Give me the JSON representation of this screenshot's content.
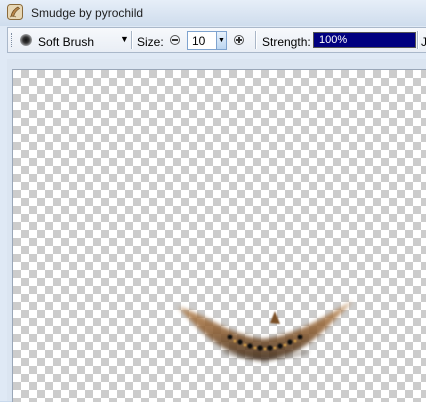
{
  "window": {
    "title": "Smudge by pyrochild"
  },
  "toolbar": {
    "brush_label": "Soft Brush",
    "size_label": "Size:",
    "size_value": "10",
    "strength_label": "Strength:",
    "strength_value": "100%",
    "strength_fraction": 1.0,
    "overflow_text": "J"
  },
  "icons": {
    "app": "smudge-finger-icon",
    "brush": "soft-brush-icon",
    "dropdown": "chevron-down-icon",
    "decrease": "minus-circle-icon",
    "increase": "plus-circle-icon",
    "spin": "spin-down-icon"
  },
  "colors": {
    "strength_fill": "#000080",
    "checker_light": "#ffffff",
    "checker_dark": "#cccccc"
  }
}
